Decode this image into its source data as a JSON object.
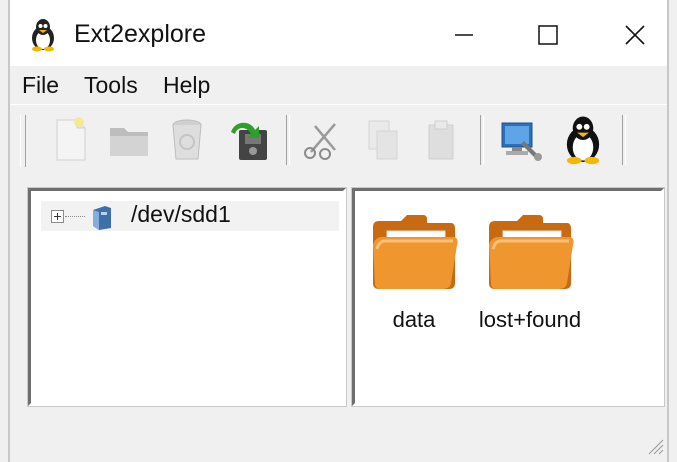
{
  "window": {
    "title": "Ext2explore",
    "controls": {
      "minimize": "minimize",
      "maximize": "maximize",
      "close": "close"
    }
  },
  "menu": [
    "File",
    "Tools",
    "Help"
  ],
  "toolbar": {
    "buttons": [
      {
        "icon": "new-file-icon",
        "enabled": false
      },
      {
        "icon": "open-folder-icon",
        "enabled": false
      },
      {
        "icon": "trash-icon",
        "enabled": false
      },
      {
        "icon": "save-export-icon",
        "enabled": true
      },
      {
        "icon": "cut-icon",
        "enabled": false
      },
      {
        "icon": "copy-icon",
        "enabled": false
      },
      {
        "icon": "paste-icon",
        "enabled": false
      },
      {
        "icon": "settings-computer-icon",
        "enabled": true
      },
      {
        "icon": "linux-tux-icon",
        "enabled": true
      }
    ]
  },
  "tree": {
    "root_label": "/dev/sdd1",
    "expander": "plus"
  },
  "files": [
    {
      "name": "data",
      "icon": "folder-icon"
    },
    {
      "name": "lost+found",
      "icon": "folder-icon"
    }
  ],
  "colors": {
    "folder": "#f0962f",
    "folder_dark": "#c86a12",
    "titlebar": "#ffffff",
    "chrome": "#f0f0f0"
  }
}
